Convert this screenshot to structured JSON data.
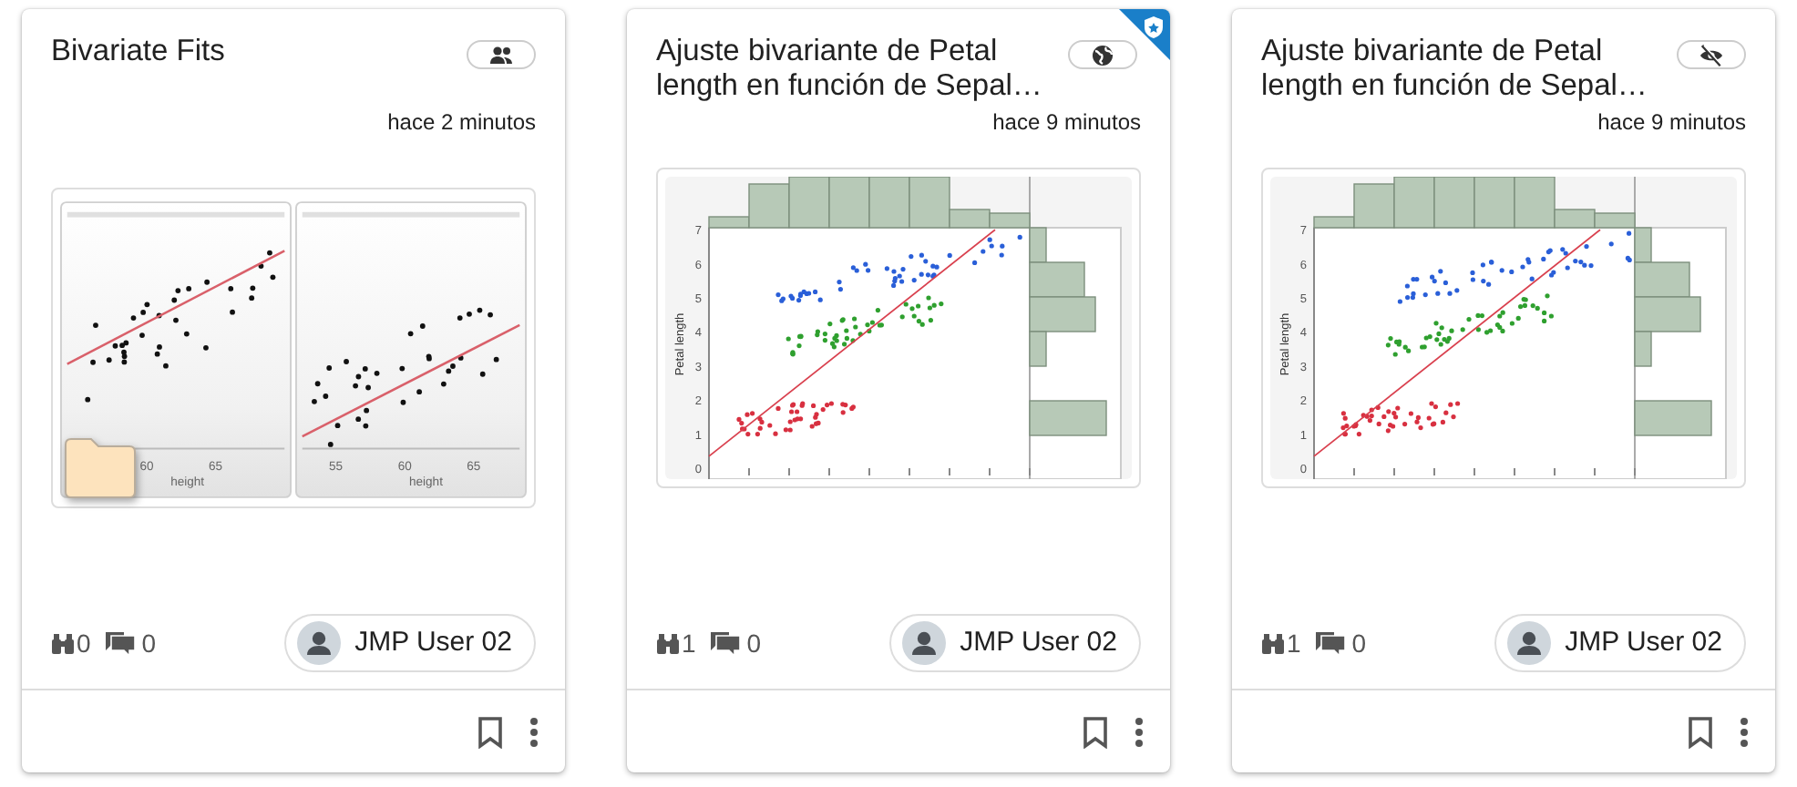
{
  "cards": [
    {
      "title": "Bivariate Fits",
      "visibility_badge": {
        "kind": "shared"
      },
      "certified": false,
      "time": "hace 2 minutos",
      "thumbnail": {
        "kind": "bivariate-pair",
        "panels": [
          {
            "x_ticks": [
              "60",
              "65"
            ],
            "x_label": "height"
          },
          {
            "x_ticks": [
              "55",
              "60",
              "65"
            ],
            "x_label": "height"
          }
        ]
      },
      "folder": true,
      "views": "0",
      "comments": "0",
      "owner": "JMP User 02"
    },
    {
      "title": "Ajuste bivariante de Petal length en función de Sepal…",
      "visibility_badge": {
        "kind": "public"
      },
      "certified": true,
      "time": "hace 9 minutos",
      "thumbnail": {
        "kind": "scatter-histogram",
        "y_ticks": [
          "7",
          "6",
          "5",
          "4",
          "3",
          "2",
          "1",
          "0"
        ],
        "y_label": "Petal length"
      },
      "folder": false,
      "views": "1",
      "comments": "0",
      "owner": "JMP User 02"
    },
    {
      "title": "Ajuste bivariante de Petal length en función de Sepal…",
      "visibility_badge": {
        "kind": "private"
      },
      "certified": false,
      "time": "hace 9 minutos",
      "thumbnail": {
        "kind": "scatter-histogram",
        "y_ticks": [
          "7",
          "6",
          "5",
          "4",
          "3",
          "2",
          "1",
          "0"
        ],
        "y_label": "Petal length"
      },
      "folder": false,
      "views": "1",
      "comments": "0",
      "owner": "JMP User 02"
    }
  ]
}
